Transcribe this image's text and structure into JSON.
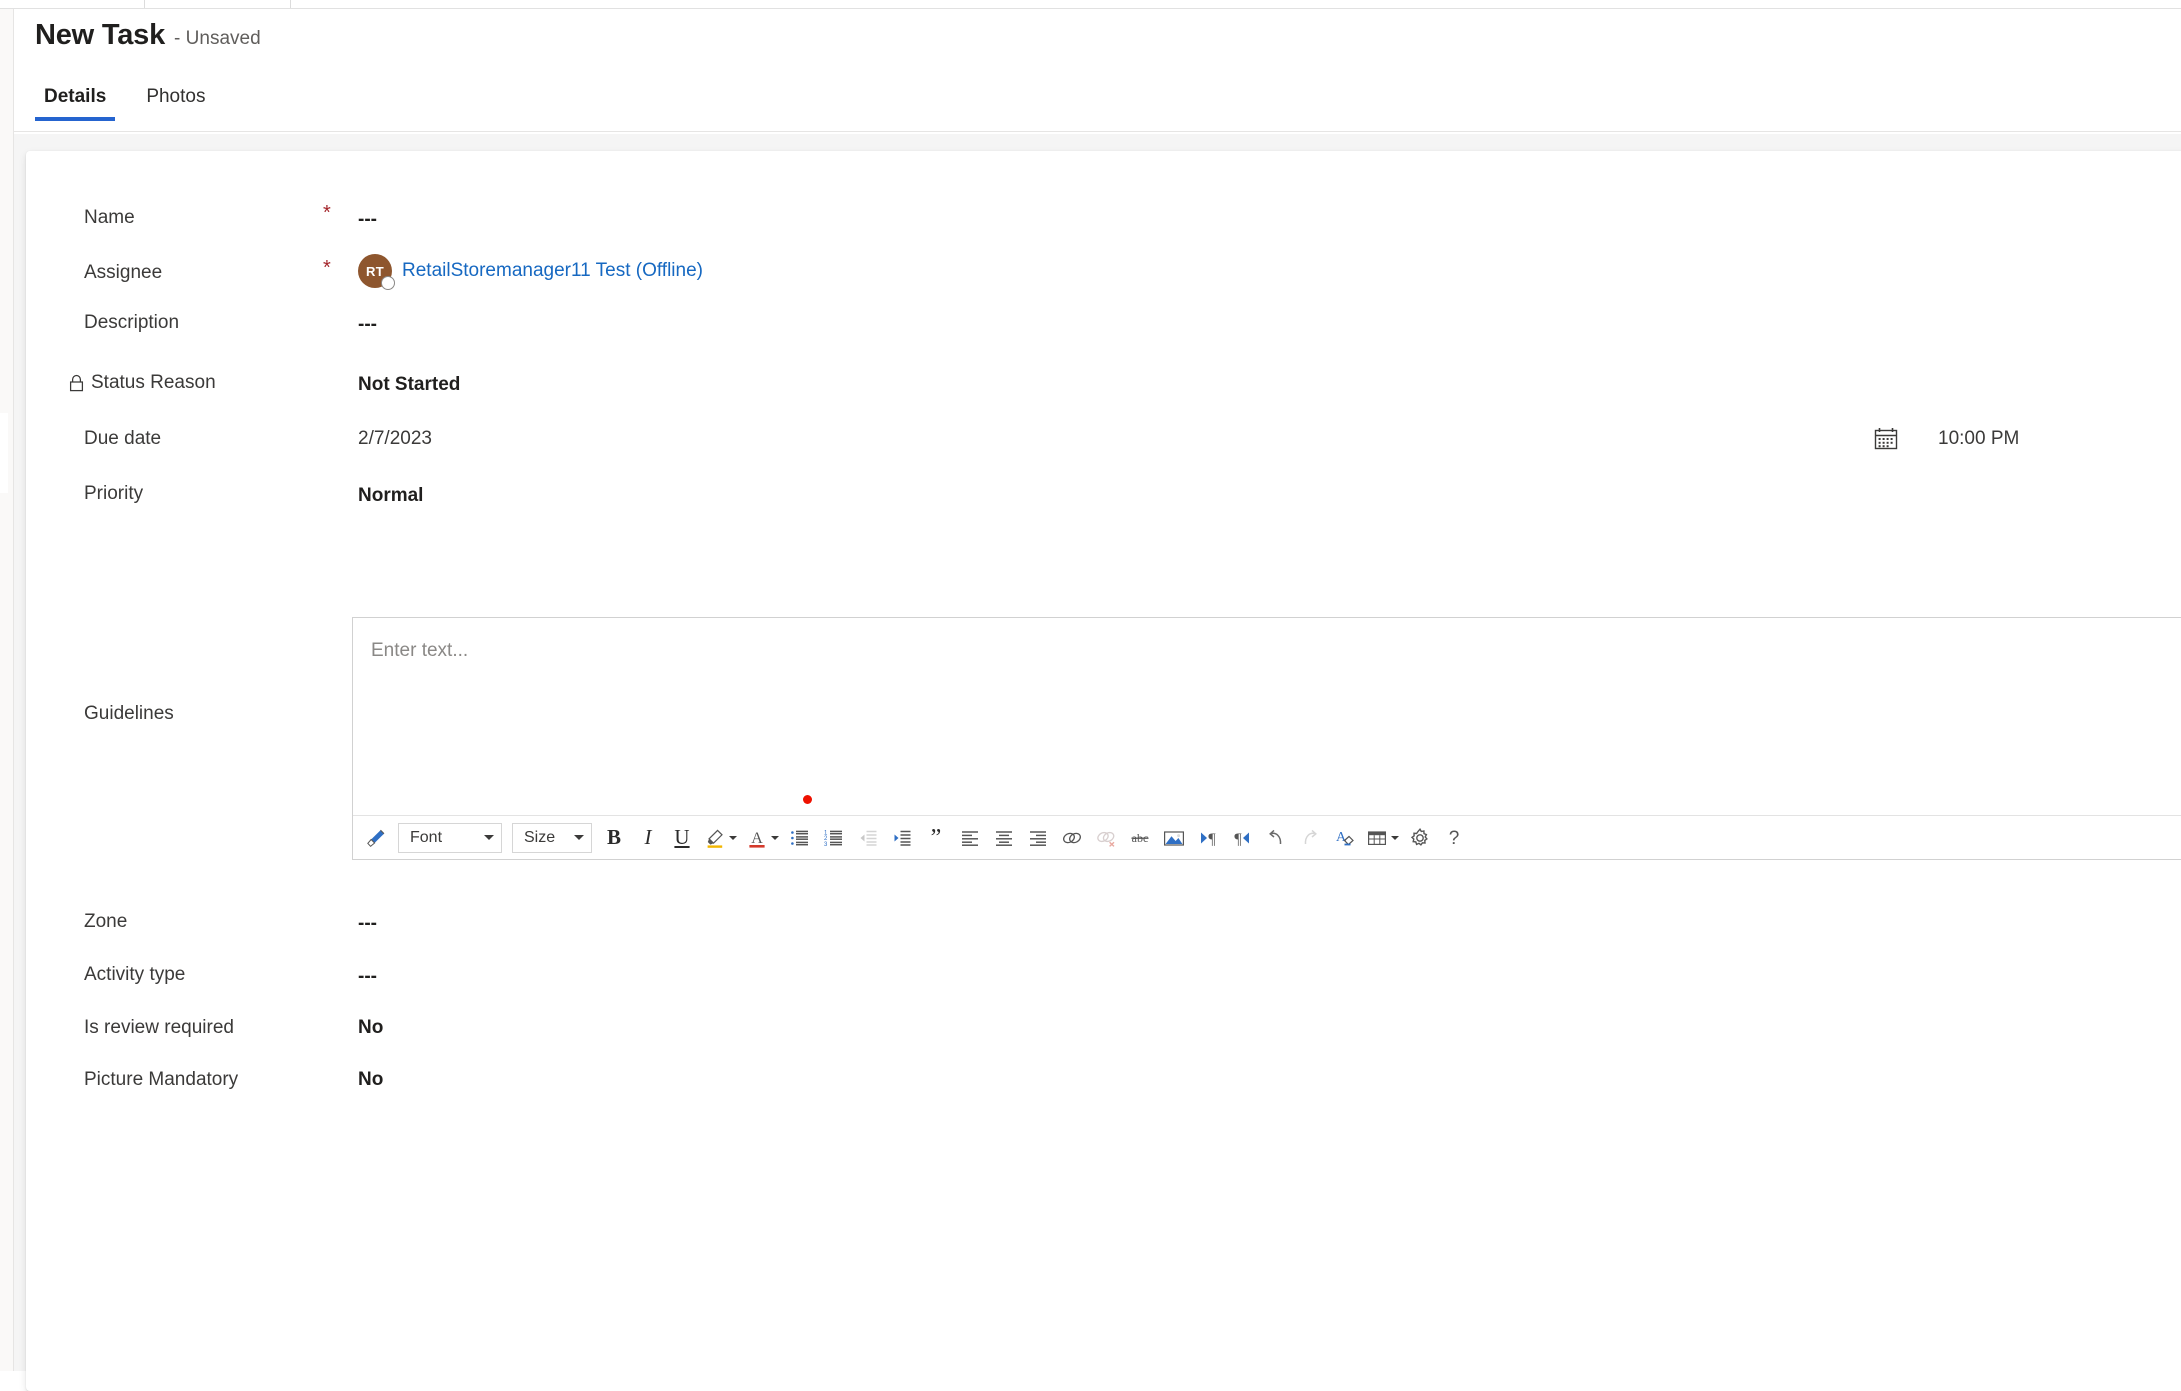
{
  "window": {
    "title_main": "New Task",
    "title_sub": "- Unsaved"
  },
  "tabs": [
    {
      "label": "Details",
      "active": true
    },
    {
      "label": "Photos",
      "active": false
    }
  ],
  "form": {
    "fields": [
      {
        "label": "Name",
        "required": true,
        "value": "---",
        "style": "dashes"
      },
      {
        "label": "Assignee",
        "required": true,
        "value": "",
        "style": "person"
      },
      {
        "label": "Description",
        "required": false,
        "value": "---",
        "style": "dashes"
      },
      {
        "label": "Status Reason",
        "required": false,
        "value": "Not Started",
        "style": "strong",
        "locked": true
      },
      {
        "label": "Due date",
        "required": false,
        "value": "2/7/2023",
        "style": "plain"
      },
      {
        "label": "Priority",
        "required": false,
        "value": "Normal",
        "style": "strong"
      },
      {
        "label": "Guidelines",
        "required": false,
        "value": "",
        "style": "editor"
      },
      {
        "label": "Zone",
        "required": false,
        "value": "---",
        "style": "dashes"
      },
      {
        "label": "Activity type",
        "required": false,
        "value": "---",
        "style": "dashes"
      },
      {
        "label": "Is review required",
        "required": false,
        "value": "No",
        "style": "strong"
      },
      {
        "label": "Picture Mandatory",
        "required": false,
        "value": "No",
        "style": "strong"
      }
    ],
    "required_marker": "*",
    "assignee": {
      "initials": "RT",
      "name": "RetailStoremanager11 Test (Offline)",
      "avatar_color": "#8e562e",
      "presence": "offline"
    },
    "due_date": {
      "date": "2/7/2023",
      "time": "10:00 PM",
      "calendar_icon": "calendar-icon"
    },
    "guidelines_editor": {
      "placeholder": "Enter text...",
      "font_label": "Font",
      "size_label": "Size",
      "toolbar": [
        {
          "name": "format-painter-icon",
          "disabled": false
        },
        {
          "name": "font-family-dropdown",
          "disabled": false
        },
        {
          "name": "font-size-dropdown",
          "disabled": false
        },
        {
          "name": "bold-icon",
          "disabled": false
        },
        {
          "name": "italic-icon",
          "disabled": false
        },
        {
          "name": "underline-icon",
          "disabled": false
        },
        {
          "name": "highlight-color-icon",
          "disabled": false
        },
        {
          "name": "font-color-icon",
          "disabled": false
        },
        {
          "name": "bulleted-list-icon",
          "disabled": false
        },
        {
          "name": "numbered-list-icon",
          "disabled": false
        },
        {
          "name": "decrease-indent-icon",
          "disabled": true
        },
        {
          "name": "increase-indent-icon",
          "disabled": false
        },
        {
          "name": "blockquote-icon",
          "disabled": false
        },
        {
          "name": "align-left-icon",
          "disabled": false
        },
        {
          "name": "align-center-icon",
          "disabled": false
        },
        {
          "name": "align-right-icon",
          "disabled": false
        },
        {
          "name": "insert-link-icon",
          "disabled": false
        },
        {
          "name": "remove-link-icon",
          "disabled": true
        },
        {
          "name": "strikethrough-icon",
          "disabled": false
        },
        {
          "name": "insert-image-icon",
          "disabled": false
        },
        {
          "name": "ltr-direction-icon",
          "disabled": false
        },
        {
          "name": "rtl-direction-icon",
          "disabled": false
        },
        {
          "name": "undo-icon",
          "disabled": false
        },
        {
          "name": "redo-icon",
          "disabled": true
        },
        {
          "name": "clear-formatting-icon",
          "disabled": false
        },
        {
          "name": "insert-table-icon",
          "disabled": false
        },
        {
          "name": "editor-settings-icon",
          "disabled": false
        },
        {
          "name": "help-icon",
          "disabled": false
        }
      ]
    }
  },
  "colors": {
    "accent": "#2564cf",
    "link": "#1668c1",
    "required": "#a4262c",
    "avatar": "#8e562e",
    "marker_dot": "#ee1100"
  }
}
